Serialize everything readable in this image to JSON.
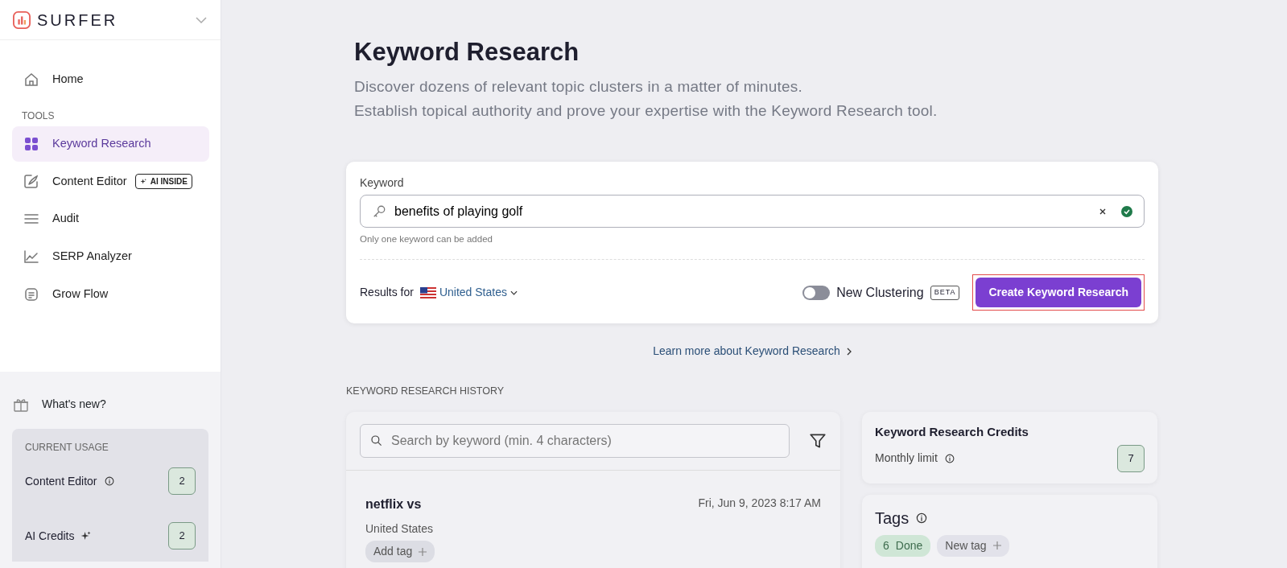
{
  "sidebar": {
    "logo": "SURFER",
    "nav": [
      {
        "kind": "item",
        "label": "Home",
        "selected": false
      },
      {
        "kind": "section",
        "label": "TOOLS"
      },
      {
        "kind": "item",
        "label": "Keyword Research",
        "selected": true
      },
      {
        "kind": "item",
        "label": "Content Editor",
        "selected": false,
        "badge": "AI INSIDE"
      },
      {
        "kind": "item",
        "label": "Audit",
        "selected": false
      },
      {
        "kind": "item",
        "label": "SERP Analyzer",
        "selected": false
      },
      {
        "kind": "item",
        "label": "Grow Flow",
        "selected": false
      }
    ],
    "whats_new": "What's new?",
    "usage": {
      "title": "CURRENT USAGE",
      "items": [
        {
          "label": "Content Editor",
          "count": "2"
        },
        {
          "label": "AI Credits",
          "count": "2"
        }
      ]
    }
  },
  "header": {
    "title": "Keyword Research",
    "subtitle": [
      "Discover dozens of relevant topic clusters in a matter of minutes.",
      "Establish topical authority and prove your expertise with the Keyword Research tool."
    ]
  },
  "keyword_form": {
    "label": "Keyword",
    "value": "benefits of playing golf",
    "hint": "Only one keyword can be added",
    "valid": true,
    "results_for": "Results for",
    "country": "United States",
    "toggle": {
      "label": "New Clustering",
      "on": false,
      "badge": "BETA"
    },
    "submit": "Create Keyword Research",
    "highlighted": true
  },
  "learn_more": "Learn more about Keyword Research",
  "history": {
    "title": "KEYWORD RESEARCH HISTORY",
    "search": {
      "placeholder": "Search by keyword (min. 4 characters)"
    },
    "entries": [
      {
        "keyword": "netflix vs",
        "date": "Fri, Jun 9, 2023 8:17 AM",
        "country": "United States",
        "add_tag": "Add tag"
      }
    ]
  },
  "credits": {
    "title": "Keyword Research Credits",
    "label": "Monthly limit",
    "value": "7"
  },
  "tags": {
    "title": "Tags",
    "items": [
      {
        "count": "6",
        "label": "Done",
        "color": "#cfe6d6"
      },
      {
        "label": "New tag",
        "color": "#e2e2ea"
      }
    ]
  }
}
